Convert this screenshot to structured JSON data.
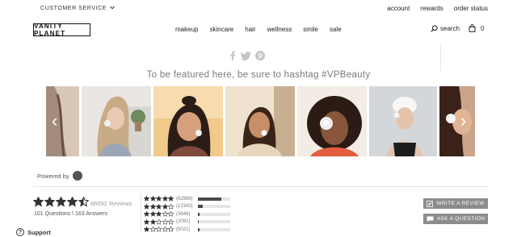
{
  "topbar": {
    "customer_service": "CUSTOMER SERVICE",
    "links": [
      "account",
      "rewards",
      "order status"
    ]
  },
  "header": {
    "logo": "VANITY PLANET",
    "nav": [
      "makeup",
      "skincare",
      "hair",
      "wellness",
      "smile",
      "sale"
    ],
    "search_label": "search",
    "cart_count": "0"
  },
  "ugc": {
    "hashtag_text": "To be featured here, be sure to hashtag #VPBeauty",
    "powered_by": "Powered by"
  },
  "reviews": {
    "average_rating": 4.5,
    "count_text": "86092 Reviews",
    "qa_text": "101 Questions \\ 163 Answers",
    "distribution": [
      {
        "stars": 5,
        "count": "(62988)",
        "fraction": 0.73
      },
      {
        "stars": 4,
        "count": "(12343)",
        "fraction": 0.14
      },
      {
        "stars": 3,
        "count": "(3648)",
        "fraction": 0.04
      },
      {
        "stars": 2,
        "count": "(2091)",
        "fraction": 0.025
      },
      {
        "stars": 1,
        "count": "(5021)",
        "fraction": 0.06
      }
    ],
    "write_review": "WRITE A REVIEW",
    "ask_question": "ASK A QUESTION"
  },
  "support": {
    "label": "Support"
  },
  "colors": {
    "button_gray": "#8c8c8c",
    "hashtag_text": "#7a7a7a",
    "star": "#333333"
  }
}
